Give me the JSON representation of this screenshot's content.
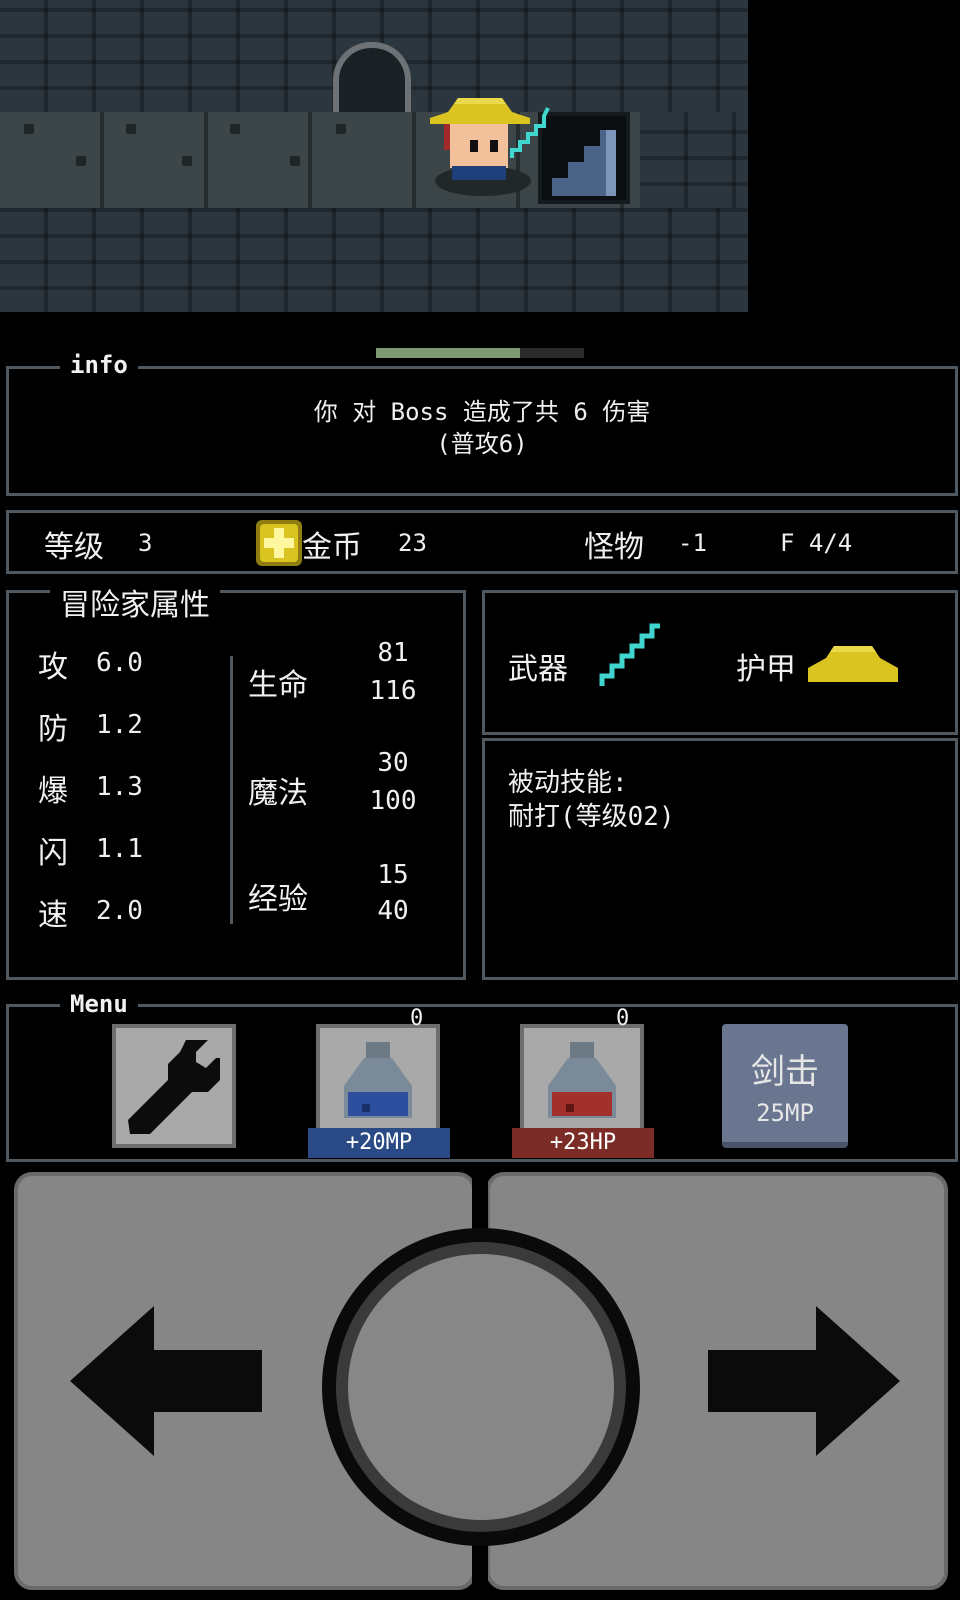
{
  "info": {
    "title": "info",
    "message": "你 对 Boss 造成了共 6 伤害",
    "detail": "(普攻6)"
  },
  "boss_hp_fraction": 0.69,
  "status": {
    "level_label": "等级",
    "level_value": "3",
    "gold_label": "金币",
    "gold_value": "23",
    "monsters_label": "怪物",
    "monsters_value": "-1",
    "floor": "F 4/4"
  },
  "attributes": {
    "title": "冒险家属性",
    "stats": [
      {
        "label": "攻",
        "value": "6.0"
      },
      {
        "label": "防",
        "value": "1.2"
      },
      {
        "label": "爆",
        "value": "1.3"
      },
      {
        "label": "闪",
        "value": "1.1"
      },
      {
        "label": "速",
        "value": "2.0"
      }
    ],
    "life_label": "生命",
    "life_current": "81",
    "life_max": "116",
    "magic_label": "魔法",
    "magic_current": "30",
    "magic_max": "100",
    "exp_label": "经验",
    "exp_current": "15",
    "exp_max": "40"
  },
  "equipment": {
    "weapon_label": "武器",
    "weapon_icon": "lightning-sword-icon",
    "armor_label": "护甲",
    "armor_icon": "straw-hat-icon"
  },
  "passive": {
    "title": "被动技能:",
    "skill": "耐打(等级02)"
  },
  "menu": {
    "title": "Menu",
    "settings_icon": "wrench-icon",
    "mp_potion_count": "0",
    "mp_potion_effect": "+20MP",
    "hp_potion_count": "0",
    "hp_potion_effect": "+23HP",
    "skill_name": "剑击",
    "skill_cost": "25MP"
  },
  "colors": {
    "panel_border": "#4e5962",
    "hat_yellow": "#d9c421",
    "weapon_cyan": "#3fd6d0",
    "mp_blue": "#2a4a86",
    "hp_red": "#7c2c26",
    "skill_button": "#6a7690"
  }
}
